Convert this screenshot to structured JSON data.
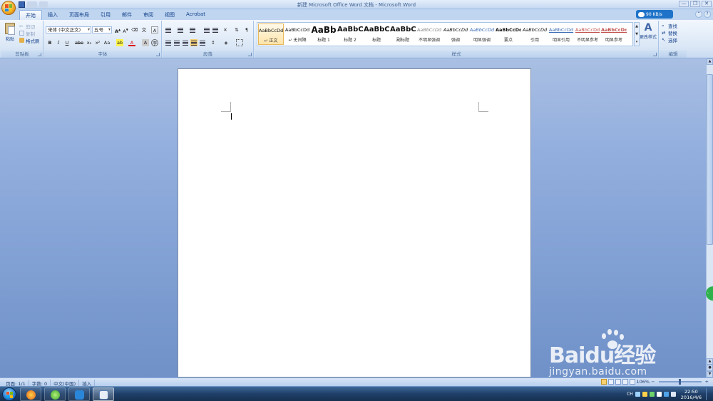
{
  "window": {
    "title": "新建 Microsoft Office Word 文档 - Microsoft Word",
    "controls": [
      "—",
      "❐",
      "✕"
    ]
  },
  "tabs": [
    "开始",
    "插入",
    "页面布局",
    "引用",
    "邮件",
    "审阅",
    "视图",
    "Acrobat"
  ],
  "active_tab": "开始",
  "net_speed": "90 KB/s",
  "clipboard": {
    "paste_label": "粘贴",
    "cut_label": "剪切",
    "copy_label": "复制",
    "format_painter_label": "格式刷",
    "group_label": "剪贴板"
  },
  "font": {
    "font_name": "宋体 (中文正文)",
    "font_size": "五号",
    "group_label": "字体",
    "buttons": [
      "B",
      "I",
      "U",
      "abe",
      "x₂",
      "x²",
      "Aa",
      "A",
      "A"
    ]
  },
  "paragraph": {
    "group_label": "段落"
  },
  "styles": {
    "group_label": "样式",
    "items": [
      {
        "preview": "AaBbCcDd",
        "name": "↵ 正文"
      },
      {
        "preview": "AaBbCcDd",
        "name": "↵ 无间隔"
      },
      {
        "preview": "AaBb",
        "name": "标题 1"
      },
      {
        "preview": "AaBbC",
        "name": "标题 2"
      },
      {
        "preview": "AaBbC",
        "name": "标题"
      },
      {
        "preview": "AaBbC",
        "name": "副标题"
      },
      {
        "preview": "AaBbCcDd",
        "name": "不明显强调"
      },
      {
        "preview": "AaBbCcDd",
        "name": "强调"
      },
      {
        "preview": "AaBbCcDd",
        "name": "明显强调"
      },
      {
        "preview": "AaBbCcDd",
        "name": "要点"
      },
      {
        "preview": "AaBbCcDd",
        "name": "引用"
      },
      {
        "preview": "AaBbCcDd",
        "name": "明显引用"
      },
      {
        "preview": "AaBbCcDd",
        "name": "不明显参考"
      },
      {
        "preview": "AaBbCcDd",
        "name": "明显参考"
      }
    ],
    "change_styles_label": "更改样式"
  },
  "editing": {
    "group_label": "编辑",
    "find_label": "查找",
    "replace_label": "替换",
    "select_label": "选择"
  },
  "status": {
    "page": "页面: 1/1",
    "words": "字数: 0",
    "language": "中文(中国)",
    "mode": "插入",
    "zoom": "106%"
  },
  "watermark": {
    "brand": "Baidu经验",
    "url": "jingyan.baidu.com"
  },
  "taskbar": {
    "lang": "CH",
    "time": "22:50",
    "date": "2016/4/6"
  },
  "colors": {
    "accent": "#15428b",
    "ribbon_bg": "#dbe7f6",
    "workspace_bg": "#92aede",
    "taskbar_bg": "#1f3f69"
  }
}
